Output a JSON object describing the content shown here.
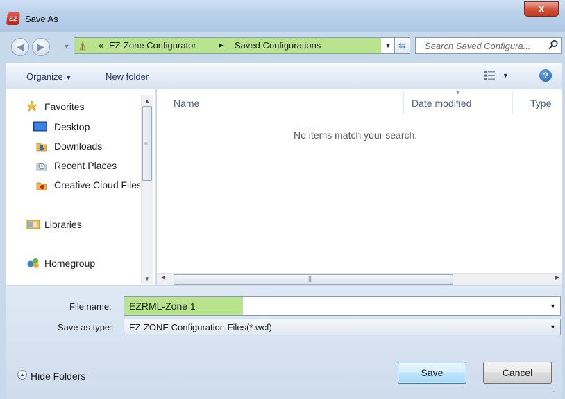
{
  "window": {
    "title": "Save As",
    "app_icon_text": "EZ",
    "close_label": "X"
  },
  "navigation": {
    "path_chevron": "«",
    "path_segments": [
      "EZ-Zone Configurator",
      "Saved Configurations"
    ],
    "search_placeholder": "Search Saved Configura..."
  },
  "toolbar": {
    "organize_label": "Organize",
    "new_folder_label": "New folder",
    "help_label": "?"
  },
  "sidebar": {
    "items": [
      {
        "label": "Favorites",
        "icon": "star-icon"
      },
      {
        "label": "Desktop",
        "icon": "desktop-icon"
      },
      {
        "label": "Downloads",
        "icon": "downloads-folder-icon"
      },
      {
        "label": "Recent Places",
        "icon": "recent-places-icon"
      },
      {
        "label": "Creative Cloud Files",
        "icon": "creative-cloud-icon"
      },
      {
        "label": "Libraries",
        "icon": "libraries-icon"
      },
      {
        "label": "Homegroup",
        "icon": "homegroup-icon"
      }
    ]
  },
  "file_list": {
    "columns": [
      "Name",
      "Date modified",
      "Type"
    ],
    "empty_message": "No items match your search."
  },
  "form": {
    "filename_label": "File name:",
    "filename_value": "EZRML-Zone 1",
    "savetype_label": "Save as type:",
    "savetype_value": "EZ-ZONE Configuration Files(*.wcf)"
  },
  "footer": {
    "hide_folders_label": "Hide Folders",
    "save_label": "Save",
    "cancel_label": "Cancel"
  },
  "colors": {
    "highlight_green": "#b7e48c",
    "toolbar_text": "#1e395b",
    "column_header_text": "#4c607a"
  }
}
